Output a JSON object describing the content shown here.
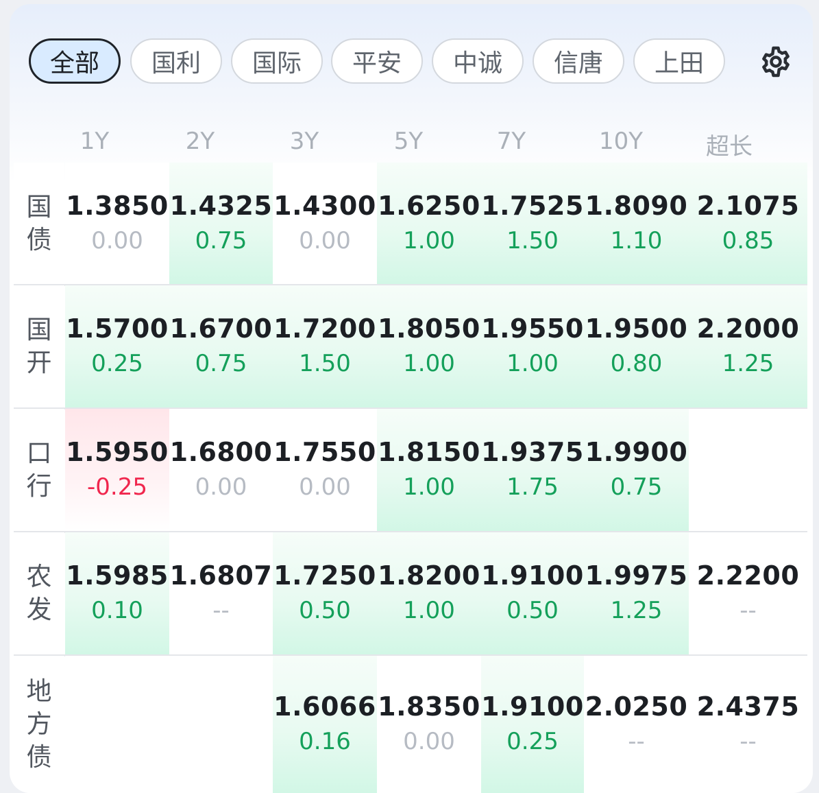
{
  "tabs": [
    {
      "label": "全部",
      "active": true
    },
    {
      "label": "国利",
      "active": false
    },
    {
      "label": "国际",
      "active": false
    },
    {
      "label": "平安",
      "active": false
    },
    {
      "label": "中诚",
      "active": false
    },
    {
      "label": "信唐",
      "active": false
    },
    {
      "label": "上田",
      "active": false
    }
  ],
  "settings_icon": "gear-icon",
  "columns": [
    "1Y",
    "2Y",
    "3Y",
    "5Y",
    "7Y",
    "10Y",
    "超长"
  ],
  "rows": [
    {
      "label": "国债",
      "cells": [
        {
          "price": "1.3850",
          "change": "0.00",
          "trend": "flat"
        },
        {
          "price": "1.4325",
          "change": "0.75",
          "trend": "up"
        },
        {
          "price": "1.4300",
          "change": "0.00",
          "trend": "flat"
        },
        {
          "price": "1.6250",
          "change": "1.00",
          "trend": "up"
        },
        {
          "price": "1.7525",
          "change": "1.50",
          "trend": "up"
        },
        {
          "price": "1.8090",
          "change": "1.10",
          "trend": "up"
        },
        {
          "price": "2.1075",
          "change": "0.85",
          "trend": "up"
        }
      ]
    },
    {
      "label": "国开",
      "cells": [
        {
          "price": "1.5700",
          "change": "0.25",
          "trend": "up"
        },
        {
          "price": "1.6700",
          "change": "0.75",
          "trend": "up"
        },
        {
          "price": "1.7200",
          "change": "1.50",
          "trend": "up"
        },
        {
          "price": "1.8050",
          "change": "1.00",
          "trend": "up"
        },
        {
          "price": "1.9550",
          "change": "1.00",
          "trend": "up"
        },
        {
          "price": "1.9500",
          "change": "0.80",
          "trend": "up"
        },
        {
          "price": "2.2000",
          "change": "1.25",
          "trend": "up"
        }
      ]
    },
    {
      "label": "口行",
      "cells": [
        {
          "price": "1.5950",
          "change": "-0.25",
          "trend": "down"
        },
        {
          "price": "1.6800",
          "change": "0.00",
          "trend": "flat"
        },
        {
          "price": "1.7550",
          "change": "0.00",
          "trend": "flat"
        },
        {
          "price": "1.8150",
          "change": "1.00",
          "trend": "up"
        },
        {
          "price": "1.9375",
          "change": "1.75",
          "trend": "up"
        },
        {
          "price": "1.9900",
          "change": "0.75",
          "trend": "up"
        },
        null
      ]
    },
    {
      "label": "农发",
      "cells": [
        {
          "price": "1.5985",
          "change": "0.10",
          "trend": "up"
        },
        {
          "price": "1.6807",
          "change": "--",
          "trend": "none"
        },
        {
          "price": "1.7250",
          "change": "0.50",
          "trend": "up"
        },
        {
          "price": "1.8200",
          "change": "1.00",
          "trend": "up"
        },
        {
          "price": "1.9100",
          "change": "0.50",
          "trend": "up"
        },
        {
          "price": "1.9975",
          "change": "1.25",
          "trend": "up"
        },
        {
          "price": "2.2200",
          "change": "--",
          "trend": "none"
        }
      ]
    },
    {
      "label": "地方债",
      "cells": [
        null,
        null,
        {
          "price": "1.6066",
          "change": "0.16",
          "trend": "up"
        },
        {
          "price": "1.8350",
          "change": "0.00",
          "trend": "flat"
        },
        {
          "price": "1.9100",
          "change": "0.25",
          "trend": "up"
        },
        {
          "price": "2.0250",
          "change": "--",
          "trend": "none"
        },
        {
          "price": "2.4375",
          "change": "--",
          "trend": "none"
        }
      ]
    }
  ],
  "colors": {
    "up": "#14a05a",
    "down": "#f0264d",
    "flat": "#b6bbc3",
    "active_tab_bg": "#d9ebff"
  }
}
